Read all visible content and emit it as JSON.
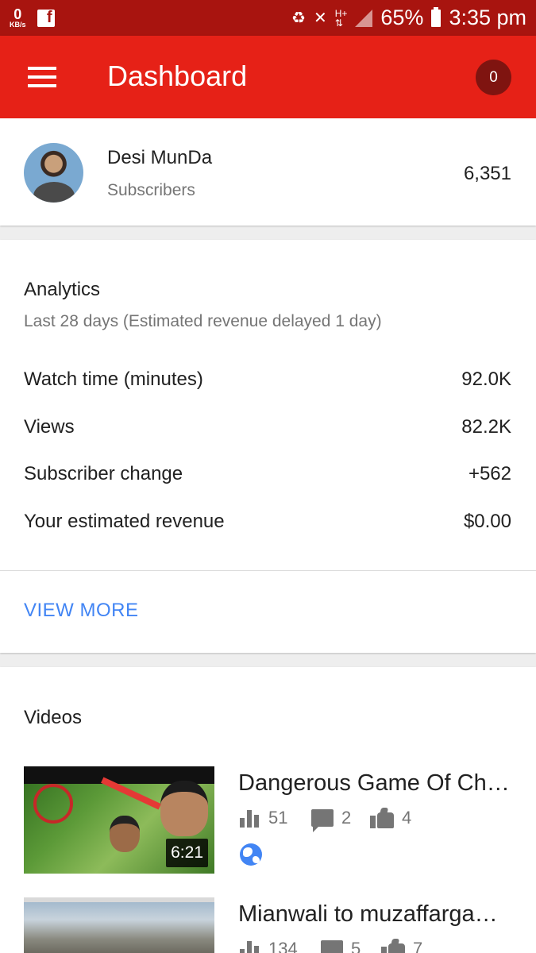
{
  "status_bar": {
    "speed_value": "0",
    "speed_unit": "KB/s",
    "fb_icon": "facebook-icon",
    "battery": "65%",
    "time": "3:35 pm"
  },
  "app_bar": {
    "title": "Dashboard",
    "notifications": "0",
    "background": "#e62117"
  },
  "channel": {
    "name": "Desi MunDa",
    "subscribers_label": "Subscribers",
    "subscriber_count": "6,351"
  },
  "analytics": {
    "title": "Analytics",
    "subtitle": "Last 28 days (Estimated revenue delayed 1 day)",
    "metrics": [
      {
        "label": "Watch time (minutes)",
        "value": "92.0K"
      },
      {
        "label": "Views",
        "value": "82.2K"
      },
      {
        "label": "Subscriber change",
        "value": "+562"
      },
      {
        "label": "Your estimated revenue",
        "value": "$0.00"
      }
    ],
    "view_more": "VIEW MORE",
    "link_color": "#4285f4"
  },
  "videos": {
    "title": "Videos",
    "items": [
      {
        "title": "Dangerous Game Of Chi…",
        "duration": "6:21",
        "views": "51",
        "comments": "2",
        "likes": "4",
        "visibility_icon": "globe-icon"
      },
      {
        "title": "Mianwali to muzaffarga…",
        "views": "134",
        "comments": "5",
        "likes": "7"
      }
    ]
  }
}
